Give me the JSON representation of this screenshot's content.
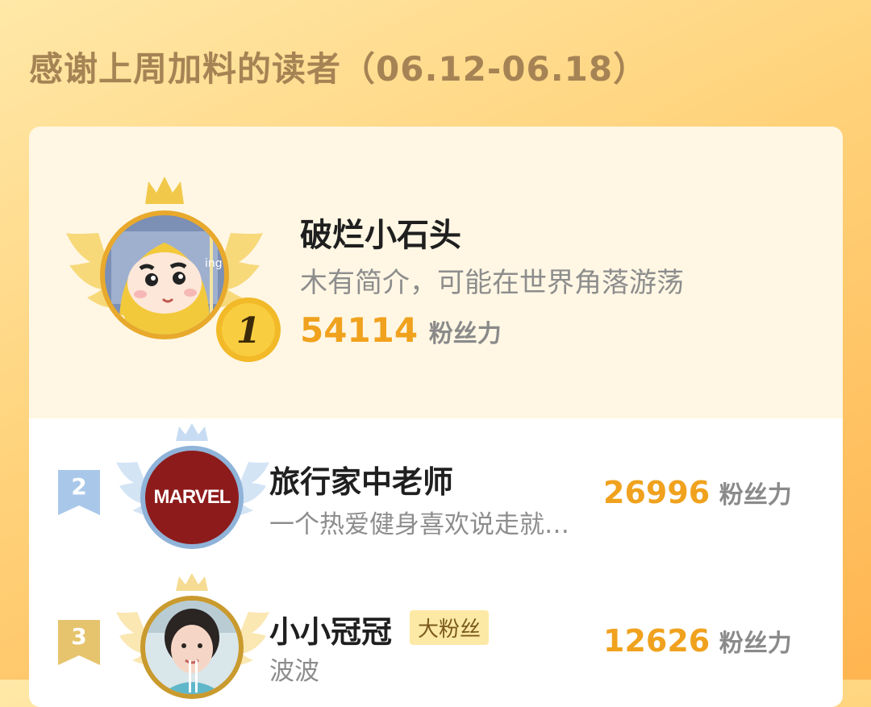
{
  "header": {
    "title": "感谢上周加料的读者（06.12-06.18）"
  },
  "leaderboard": [
    {
      "rank": "1",
      "name": "破烂小石头",
      "bio": "木有简介，可能在世界角落游荡",
      "score": "54114",
      "score_unit": "粉丝力",
      "avatar": "cartoon-kid-yellow-raincoat",
      "colors": {
        "frame": "#f2c84b",
        "medal": "#f2b928",
        "ring": "#e8a92c"
      }
    },
    {
      "rank": "2",
      "name": "旅行家中老师",
      "bio": "一个热爱健身喜欢说走就…",
      "score": "26996",
      "score_unit": "粉丝力",
      "avatar_text": "MARVEL",
      "colors": {
        "frame": "#bcd6f0",
        "tag": "#a9c8e9",
        "ring": "#8fb3d9"
      }
    },
    {
      "rank": "3",
      "name": "小小冠冠",
      "badge": "大粉丝",
      "bio": "波波",
      "score": "12626",
      "score_unit": "粉丝力",
      "avatar": "girl-photo",
      "colors": {
        "frame": "#f6dc93",
        "tag": "#e6c46d",
        "ring": "#c99a2e"
      }
    }
  ]
}
